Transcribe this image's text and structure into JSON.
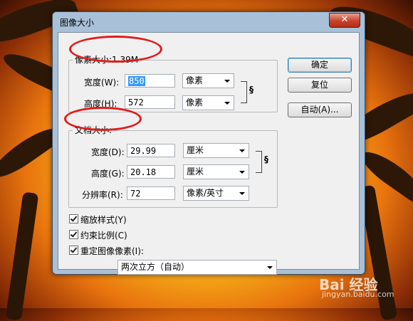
{
  "window": {
    "title": "图像大小",
    "close_glyph": "✕"
  },
  "pixel_dimensions": {
    "legend": "像素大小:1.39M",
    "width_label": "宽度(W):",
    "width_value": "850",
    "width_unit": "像素",
    "height_label": "高度(H):",
    "height_value": "572",
    "height_unit": "像素"
  },
  "document_size": {
    "legend": "文档大小:",
    "width_label": "宽度(D):",
    "width_value": "29.99",
    "width_unit": "厘米",
    "height_label": "高度(G):",
    "height_value": "20.18",
    "height_unit": "厘米",
    "resolution_label": "分辨率(R):",
    "resolution_value": "72",
    "resolution_unit": "像素/英寸"
  },
  "buttons": {
    "ok": "确定",
    "reset": "复位",
    "auto": "自动(A)..."
  },
  "options": {
    "scale_styles": "缩放样式(Y)",
    "constrain_proportions": "约束比例(C)",
    "resample": "重定图像像素(I):",
    "resample_method": "两次立方（自动）"
  },
  "watermark": {
    "brand": "Bai 经验",
    "url": "jingyan.baidu.com"
  },
  "colors": {
    "annotation_oval": "#e01c1c",
    "title_bar": "#a8c0d8",
    "close_button": "#c8412a"
  }
}
